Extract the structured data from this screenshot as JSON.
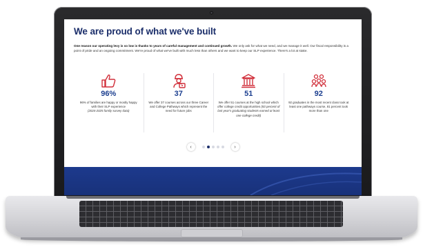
{
  "page": {
    "heading": "We are proud of what we've built",
    "intro_bold": "One reason our operating levy is so low is thanks to years of careful management and continued growth.",
    "intro_text": " We only ask for what we need, and we manage it well. Our fiscal responsibility is a point of pride and an ongoing commitment. We're proud of what we've built with much less than others and we want to keep our SLP experience. There's a lot at stake."
  },
  "stats": [
    {
      "icon": "thumbs-up-icon",
      "value": "96%",
      "desc": "96% of families are happy or mostly happy with their SLP experience",
      "desc_italic": "(2024-2025 family survey data)"
    },
    {
      "icon": "worker-icon",
      "value": "37",
      "desc": "We offer 37 courses across our three Career and College Pathways which represent the need for future jobs",
      "desc_italic": ""
    },
    {
      "icon": "institution-icon",
      "value": "51",
      "desc": "We offer 51 courses at the high school which offer college credit opportunities",
      "desc_italic": "(83 percent of last year's graduating students earned at least one college credit)"
    },
    {
      "icon": "group-icon",
      "value": "92",
      "desc": "92 graduates in the most recent class took at least one pathways course, 81 percent took more than one",
      "desc_italic": ""
    }
  ],
  "pager": {
    "prev": "‹",
    "next": "›",
    "dot_count": 5,
    "active_index": 1
  },
  "colors": {
    "heading": "#1b2e6a",
    "icon_red": "#d12f3a",
    "value_blue": "#1b3e8f",
    "footer_blue": "#1d3a8d"
  }
}
